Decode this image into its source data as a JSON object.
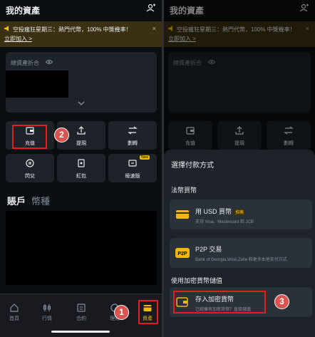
{
  "left": {
    "title": "我的資產",
    "banner": {
      "text": "空投瘋狂星期三：熱門代幣，100% 中獎幾率！",
      "link": "立即加入 >",
      "close": "×"
    },
    "asset_label": "總資產折合",
    "actions": [
      {
        "label": "充值"
      },
      {
        "label": "提現"
      },
      {
        "label": "劃轉"
      },
      {
        "label": "閃兌"
      },
      {
        "label": "紅包"
      },
      {
        "label": "極速版",
        "badge": "New"
      }
    ],
    "tabs": [
      "賬戶",
      "幣種"
    ],
    "nav": [
      {
        "label": "首頁"
      },
      {
        "label": "行情"
      },
      {
        "label": "合約"
      },
      {
        "label": "理財"
      },
      {
        "label": "資產"
      }
    ]
  },
  "right": {
    "title": "我的資產",
    "banner": {
      "text": "空投瘋狂星期三：熱門代幣，100% 中獎幾率！",
      "link": "立即加入 >",
      "close": "×"
    },
    "asset_label": "總資產折合",
    "actions": [
      {
        "label": "充值"
      },
      {
        "label": "提現"
      },
      {
        "label": "劃轉"
      }
    ],
    "sheet": {
      "title": "選擇付款方式",
      "section_fiat": "法幣買幣",
      "opt_usd": {
        "name": "用 USD 買幣",
        "tag": "推薦",
        "desc": "支持 Visa、Mastercard 和 JCB"
      },
      "opt_p2p": {
        "name": "P2P 交易",
        "desc": "Bank of Georgia,Wise,Zelle 和更多本地支付方式",
        "icon_text": "P2P"
      },
      "section_crypto": "使用加密貨幣儲值",
      "opt_deposit": {
        "name": "存入加密貨幣",
        "desc": "已經擁有加密貨幣？直接儲值"
      }
    }
  },
  "steps": [
    "1",
    "2",
    "3"
  ],
  "colors": {
    "accent": "#f0b90b",
    "bg": "#0b0e11",
    "card": "#1e2329",
    "highlight": "#e02020",
    "step_badge": "#d9534f"
  }
}
